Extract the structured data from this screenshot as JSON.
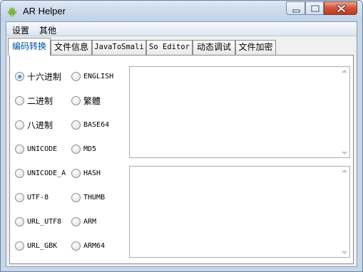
{
  "window": {
    "title": "AR Helper"
  },
  "menu": [
    {
      "label": "设置"
    },
    {
      "label": "其他"
    }
  ],
  "tabs": [
    {
      "label": "编码转换",
      "active": true
    },
    {
      "label": "文件信息"
    },
    {
      "label": "JavaToSmali"
    },
    {
      "label": "So Editor"
    },
    {
      "label": "动态调试"
    },
    {
      "label": "文件加密"
    }
  ],
  "encoding_options": {
    "left": [
      {
        "label": "十六进制",
        "checked": true
      },
      {
        "label": "二进制"
      },
      {
        "label": "八进制"
      },
      {
        "label": "UNICODE"
      },
      {
        "label": "UNICODE_A"
      },
      {
        "label": "UTF-8"
      },
      {
        "label": "URL_UTF8"
      },
      {
        "label": "URL_GBK"
      }
    ],
    "right": [
      {
        "label": "ENGLISH"
      },
      {
        "label": "繁體"
      },
      {
        "label": "BASE64"
      },
      {
        "label": "MD5"
      },
      {
        "label": "HASH"
      },
      {
        "label": "THUMB"
      },
      {
        "label": "ARM"
      },
      {
        "label": "ARM64"
      }
    ]
  },
  "input_text": "",
  "output_text": "",
  "colors": {
    "titlebar": "#c7d7ea",
    "accent": "#0050b0",
    "client_bg": "#f0f0f0"
  }
}
